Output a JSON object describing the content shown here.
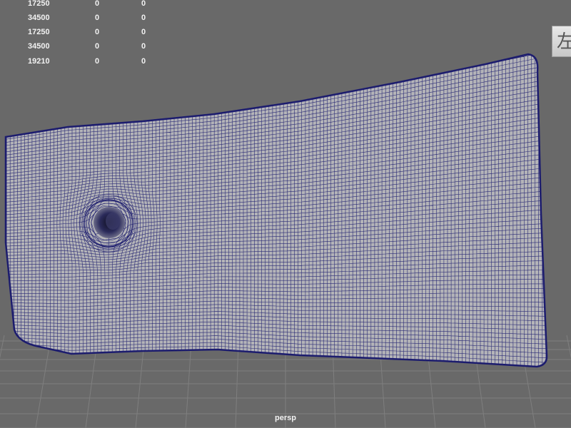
{
  "hud": {
    "rows": [
      [
        "17250",
        "0",
        "0"
      ],
      [
        "34500",
        "0",
        "0"
      ],
      [
        "17250",
        "0",
        "0"
      ],
      [
        "34500",
        "0",
        "0"
      ],
      [
        "19210",
        "0",
        "0"
      ]
    ]
  },
  "view_cube": {
    "label": "左"
  },
  "camera": {
    "label": "persp"
  },
  "colors": {
    "background": "#696969",
    "grid": "#7f7f7f",
    "mesh_fill": "#b4b4b8",
    "wireframe": "#1c1c6e"
  }
}
